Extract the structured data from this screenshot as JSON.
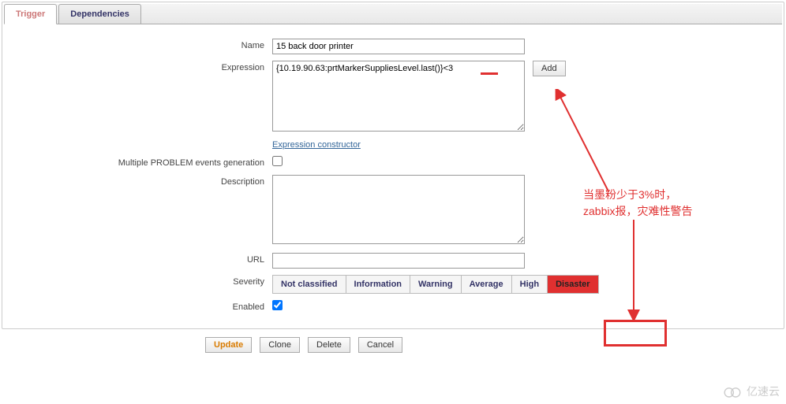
{
  "tabs": {
    "trigger": "Trigger",
    "dependencies": "Dependencies"
  },
  "labels": {
    "name": "Name",
    "expression": "Expression",
    "expression_constructor": "Expression constructor",
    "multiple_problem": "Multiple PROBLEM events generation",
    "description": "Description",
    "url": "URL",
    "severity": "Severity",
    "enabled": "Enabled"
  },
  "values": {
    "name": "15 back door printer",
    "expression": "{10.19.90.63:prtMarkerSuppliesLevel.last()}<3",
    "url": ""
  },
  "buttons": {
    "add": "Add",
    "update": "Update",
    "clone": "Clone",
    "delete": "Delete",
    "cancel": "Cancel"
  },
  "severity": {
    "not_classified": "Not classified",
    "information": "Information",
    "warning": "Warning",
    "average": "Average",
    "high": "High",
    "disaster": "Disaster"
  },
  "annotation": {
    "line1": "当墨粉少于3%时，",
    "line2": "zabbix报，灾难性警告"
  },
  "watermark": "亿速云"
}
